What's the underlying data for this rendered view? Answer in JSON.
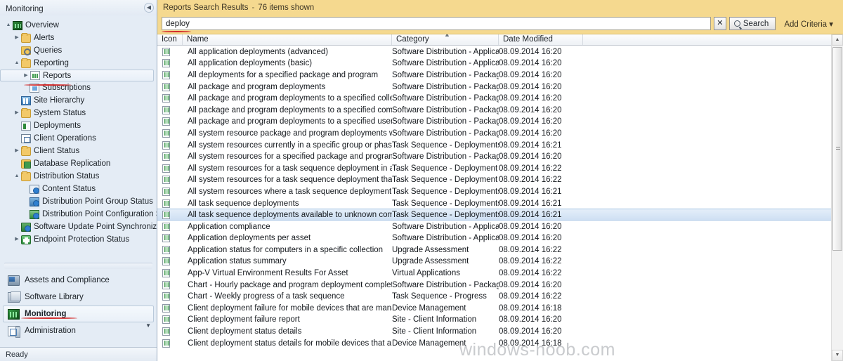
{
  "sidebar": {
    "header_title": "Monitoring",
    "collapse_icon": "◀",
    "tree": [
      {
        "label": "Overview",
        "indent": 0,
        "twist": "▲",
        "icon": "ic-green",
        "selected": false
      },
      {
        "label": "Alerts",
        "indent": 1,
        "twist": "▶",
        "icon": "ic-folder",
        "selected": false
      },
      {
        "label": "Queries",
        "indent": 1,
        "twist": "",
        "icon": "ic-query",
        "selected": false
      },
      {
        "label": "Reporting",
        "indent": 1,
        "twist": "▲",
        "icon": "ic-folder",
        "selected": false
      },
      {
        "label": "Reports",
        "indent": 2,
        "twist": "▶",
        "icon": "ic-doc",
        "selected": true
      },
      {
        "label": "Subscriptions",
        "indent": 2,
        "twist": "",
        "icon": "ic-sub",
        "selected": false
      },
      {
        "label": "Site Hierarchy",
        "indent": 1,
        "twist": "",
        "icon": "ic-site",
        "selected": false
      },
      {
        "label": "System Status",
        "indent": 1,
        "twist": "▶",
        "icon": "ic-folder",
        "selected": false
      },
      {
        "label": "Deployments",
        "indent": 1,
        "twist": "",
        "icon": "ic-deploy",
        "selected": false
      },
      {
        "label": "Client Operations",
        "indent": 1,
        "twist": "",
        "icon": "ic-clientop",
        "selected": false
      },
      {
        "label": "Client Status",
        "indent": 1,
        "twist": "▶",
        "icon": "ic-folder",
        "selected": false
      },
      {
        "label": "Database Replication",
        "indent": 1,
        "twist": "",
        "icon": "ic-db",
        "selected": false
      },
      {
        "label": "Distribution Status",
        "indent": 1,
        "twist": "▲",
        "icon": "ic-folder",
        "selected": false
      },
      {
        "label": "Content Status",
        "indent": 2,
        "twist": "",
        "icon": "ic-content",
        "selected": false
      },
      {
        "label": "Distribution Point Group Status",
        "indent": 2,
        "twist": "",
        "icon": "ic-dpg",
        "selected": false
      },
      {
        "label": "Distribution Point Configuration Status",
        "indent": 2,
        "twist": "",
        "icon": "ic-dpc",
        "selected": false
      },
      {
        "label": "Software Update Point Synchronization Status",
        "indent": 1,
        "twist": "",
        "icon": "ic-sup",
        "selected": false
      },
      {
        "label": "Endpoint Protection Status",
        "indent": 1,
        "twist": "▶",
        "icon": "ic-epp",
        "selected": false
      }
    ],
    "nav": [
      {
        "label": "Assets and Compliance",
        "icon": "ic-assets",
        "selected": false
      },
      {
        "label": "Software Library",
        "icon": "ic-swlib",
        "selected": false
      },
      {
        "label": "Monitoring",
        "icon": "ic-monitor",
        "selected": true
      },
      {
        "label": "Administration",
        "icon": "ic-admin",
        "selected": false
      }
    ],
    "nav_more_icon": "▼"
  },
  "statusbar": {
    "text": "Ready"
  },
  "search": {
    "results_title": "Reports Search Results",
    "separator": "-",
    "item_count_text": "76 items shown",
    "query_value": "deploy",
    "placeholder": "",
    "clear_label": "✕",
    "search_label": "Search",
    "add_criteria_label": "Add Criteria ▾"
  },
  "grid": {
    "columns": [
      {
        "key": "icon",
        "label": "Icon"
      },
      {
        "key": "name",
        "label": "Name"
      },
      {
        "key": "category",
        "label": "Category"
      },
      {
        "key": "date",
        "label": "Date Modified"
      }
    ],
    "sort_indicator": "▲",
    "sorted_column": "Name",
    "rows": [
      {
        "name": "All application deployments (advanced)",
        "category": "Software Distribution - Applicatio...",
        "date": "08.09.2014 16:20",
        "selected": false
      },
      {
        "name": "All application deployments (basic)",
        "category": "Software Distribution - Applicatio...",
        "date": "08.09.2014 16:20",
        "selected": false
      },
      {
        "name": "All deployments for a specified package and program",
        "category": "Software Distribution - Package a...",
        "date": "08.09.2014 16:20",
        "selected": false
      },
      {
        "name": "All package and program deployments",
        "category": "Software Distribution - Package a...",
        "date": "08.09.2014 16:20",
        "selected": false
      },
      {
        "name": "All package and program deployments to a specified collection",
        "category": "Software Distribution - Package a...",
        "date": "08.09.2014 16:20",
        "selected": false
      },
      {
        "name": "All package and program deployments to a specified computer",
        "category": "Software Distribution - Package a...",
        "date": "08.09.2014 16:20",
        "selected": false
      },
      {
        "name": "All package and program deployments to a specified user",
        "category": "Software Distribution - Package a...",
        "date": "08.09.2014 16:20",
        "selected": false
      },
      {
        "name": "All system resource package and program deployments with status",
        "category": "Software Distribution - Package a...",
        "date": "08.09.2014 16:20",
        "selected": false
      },
      {
        "name": "All system resources currently in a specific group or phase of a specific...",
        "category": "Task Sequence - Deployments",
        "date": "08.09.2014 16:21",
        "selected": false
      },
      {
        "name": "All system resources for a specified package and program deployment i...",
        "category": "Software Distribution - Package a...",
        "date": "08.09.2014 16:20",
        "selected": false
      },
      {
        "name": "All system resources for a task sequence deployment in a specific state",
        "category": "Task Sequence - Deployment Stat...",
        "date": "08.09.2014 16:22",
        "selected": false
      },
      {
        "name": "All system resources for a task sequence deployment that is in a specifi...",
        "category": "Task Sequence - Deployment Stat...",
        "date": "08.09.2014 16:22",
        "selected": false
      },
      {
        "name": "All system resources where a task sequence deployment failed within a...",
        "category": "Task Sequence - Deployments",
        "date": "08.09.2014 16:21",
        "selected": false
      },
      {
        "name": "All task sequence deployments",
        "category": "Task Sequence - Deployments",
        "date": "08.09.2014 16:21",
        "selected": false
      },
      {
        "name": "All task sequence deployments available to unknown computers",
        "category": "Task Sequence - Deployments",
        "date": "08.09.2014 16:21",
        "selected": true
      },
      {
        "name": "Application compliance",
        "category": "Software Distribution - Applicatio...",
        "date": "08.09.2014 16:20",
        "selected": false
      },
      {
        "name": "Application deployments per asset",
        "category": "Software Distribution - Applicatio...",
        "date": "08.09.2014 16:20",
        "selected": false
      },
      {
        "name": "Application status for computers in a specific collection",
        "category": "Upgrade Assessment",
        "date": "08.09.2014 16:22",
        "selected": false
      },
      {
        "name": "Application status summary",
        "category": "Upgrade Assessment",
        "date": "08.09.2014 16:22",
        "selected": false
      },
      {
        "name": "App-V Virtual Environment Results For Asset",
        "category": "Virtual Applications",
        "date": "08.09.2014 16:22",
        "selected": false
      },
      {
        "name": "Chart - Hourly package and program deployment completion status",
        "category": "Software Distribution - Package a...",
        "date": "08.09.2014 16:20",
        "selected": false
      },
      {
        "name": "Chart - Weekly progress of a task sequence",
        "category": "Task Sequence - Progress",
        "date": "08.09.2014 16:22",
        "selected": false
      },
      {
        "name": "Client deployment failure for mobile devices that are managed by the C...",
        "category": "Device Management",
        "date": "08.09.2014 16:18",
        "selected": false
      },
      {
        "name": "Client deployment failure report",
        "category": "Site - Client Information",
        "date": "08.09.2014 16:20",
        "selected": false
      },
      {
        "name": "Client deployment status details",
        "category": "Site - Client Information",
        "date": "08.09.2014 16:20",
        "selected": false
      },
      {
        "name": "Client deployment status details for mobile devices that are managed b...",
        "category": "Device Management",
        "date": "08.09.2014 16:18",
        "selected": false
      }
    ],
    "scrollbar": {
      "up_icon": "▲",
      "down_icon": "▼"
    }
  },
  "watermark": {
    "text": "windows-noob.com"
  }
}
